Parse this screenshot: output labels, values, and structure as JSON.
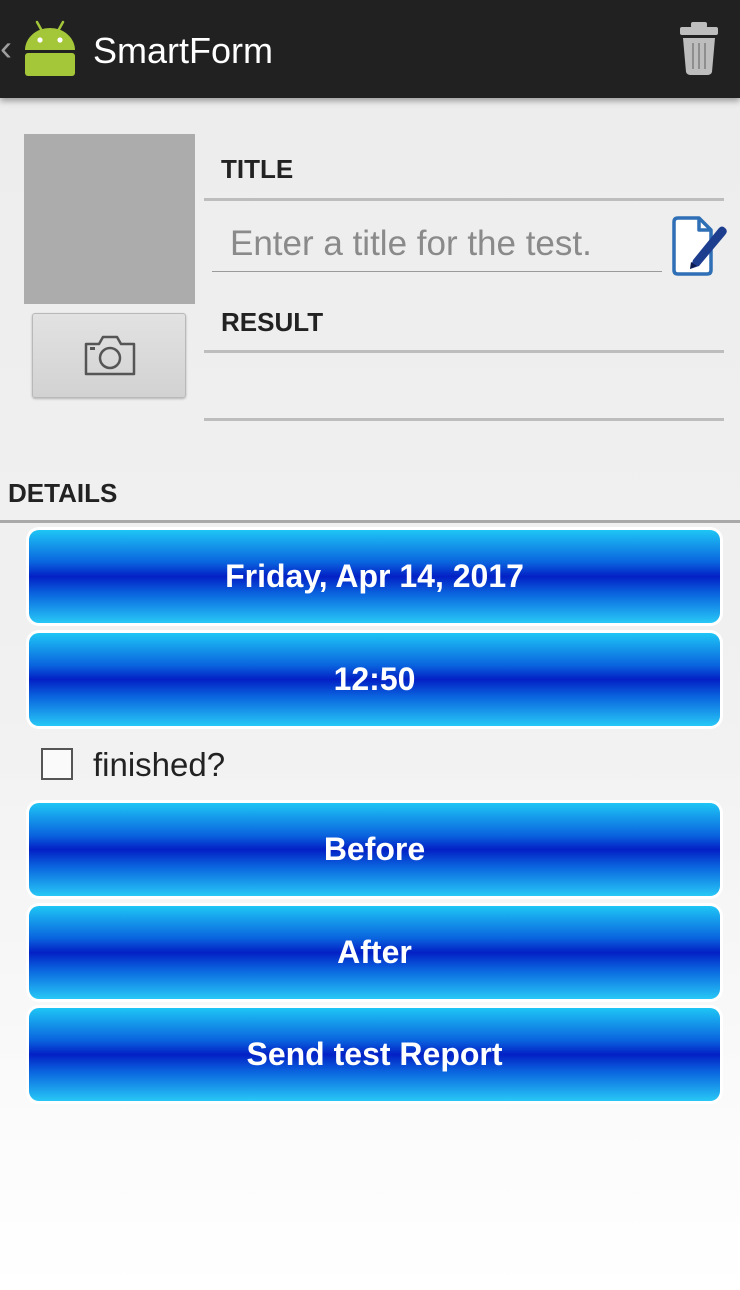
{
  "action_bar": {
    "title": "SmartForm",
    "back_icon": "chevron-left-icon",
    "logo_icon": "android-robot-icon",
    "delete_icon": "trash-icon",
    "logo_color": "#a4c639"
  },
  "form": {
    "title_label": "TITLE",
    "title_placeholder": "Enter a title for the test.",
    "title_value": "",
    "edit_icon": "edit-document-icon",
    "result_label": "RESULT",
    "result_value": "",
    "photo_icon": "camera-icon"
  },
  "details": {
    "label": "DETAILS",
    "date_button": "Friday, Apr 14, 2017",
    "time_button": "12:50",
    "finished_label": "finished?",
    "finished_checked": false,
    "before_button": "Before",
    "after_button": "After",
    "send_button": "Send test Report"
  },
  "colors": {
    "action_bar": "#212121",
    "button_blue_dark": "#0320c5",
    "button_blue_light": "#1ec5f5"
  }
}
